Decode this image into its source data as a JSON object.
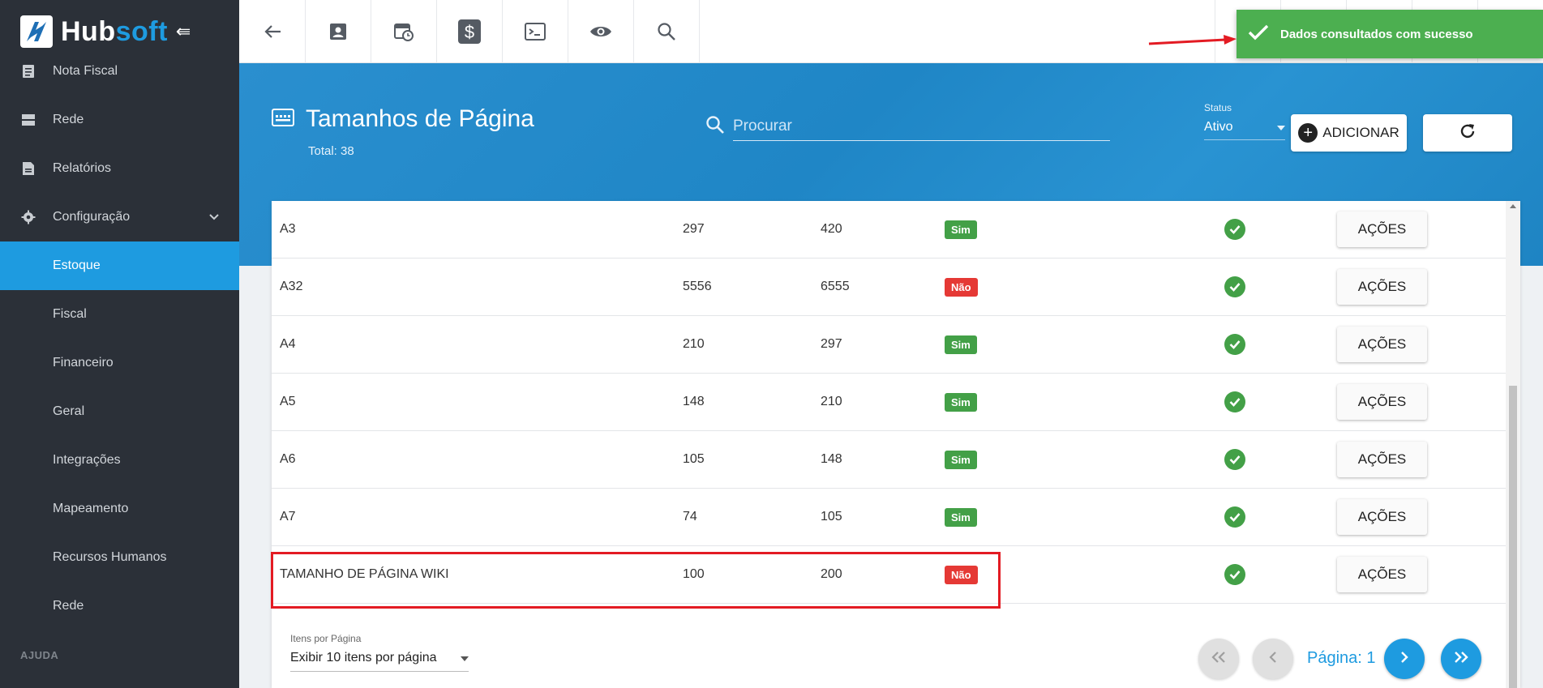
{
  "brand": {
    "hub": "Hub",
    "soft": "soft"
  },
  "sidebar": {
    "items": [
      {
        "label": "Nota Fiscal",
        "icon": "document-icon"
      },
      {
        "label": "Rede",
        "icon": "server-icon"
      },
      {
        "label": "Relatórios",
        "icon": "report-icon"
      },
      {
        "label": "Configuração",
        "icon": "gear-icon"
      }
    ],
    "subitems": [
      {
        "label": "Estoque",
        "active": true
      },
      {
        "label": "Fiscal"
      },
      {
        "label": "Financeiro"
      },
      {
        "label": "Geral"
      },
      {
        "label": "Integrações"
      },
      {
        "label": "Mapeamento"
      },
      {
        "label": "Recursos Humanos"
      },
      {
        "label": "Rede"
      }
    ],
    "section": "AJUDA"
  },
  "toolbar": {
    "icons": [
      "back-arrow-icon",
      "contact-card-icon",
      "calendar-clock-icon",
      "dollar-icon",
      "terminal-icon",
      "eye-icon",
      "search-icon"
    ]
  },
  "header": {
    "title": "Tamanhos de Página",
    "total": "Total: 38",
    "search_placeholder": "Procurar",
    "status_label": "Status",
    "status_value": "Ativo",
    "add_label": "ADICIONAR"
  },
  "table": {
    "rows": [
      {
        "name": "A3",
        "width": "297",
        "height": "420",
        "flag": "Sim",
        "action": "AÇÕES"
      },
      {
        "name": "A32",
        "width": "5556",
        "height": "6555",
        "flag": "Não",
        "action": "AÇÕES"
      },
      {
        "name": "A4",
        "width": "210",
        "height": "297",
        "flag": "Sim",
        "action": "AÇÕES"
      },
      {
        "name": "A5",
        "width": "148",
        "height": "210",
        "flag": "Sim",
        "action": "AÇÕES"
      },
      {
        "name": "A6",
        "width": "105",
        "height": "148",
        "flag": "Sim",
        "action": "AÇÕES"
      },
      {
        "name": "A7",
        "width": "74",
        "height": "105",
        "flag": "Sim",
        "action": "AÇÕES"
      },
      {
        "name": "TAMANHO DE PÁGINA WIKI",
        "width": "100",
        "height": "200",
        "flag": "Não",
        "action": "AÇÕES"
      }
    ]
  },
  "pagination": {
    "per_page_label": "Itens por Página",
    "per_page_value": "Exibir 10 itens por página",
    "page_label": "Página: 1"
  },
  "toast": {
    "message": "Dados consultados com sucesso"
  },
  "colors": {
    "accent": "#1e9be0",
    "success": "#43a047",
    "danger": "#e53935",
    "sidebar": "#2b3038"
  }
}
